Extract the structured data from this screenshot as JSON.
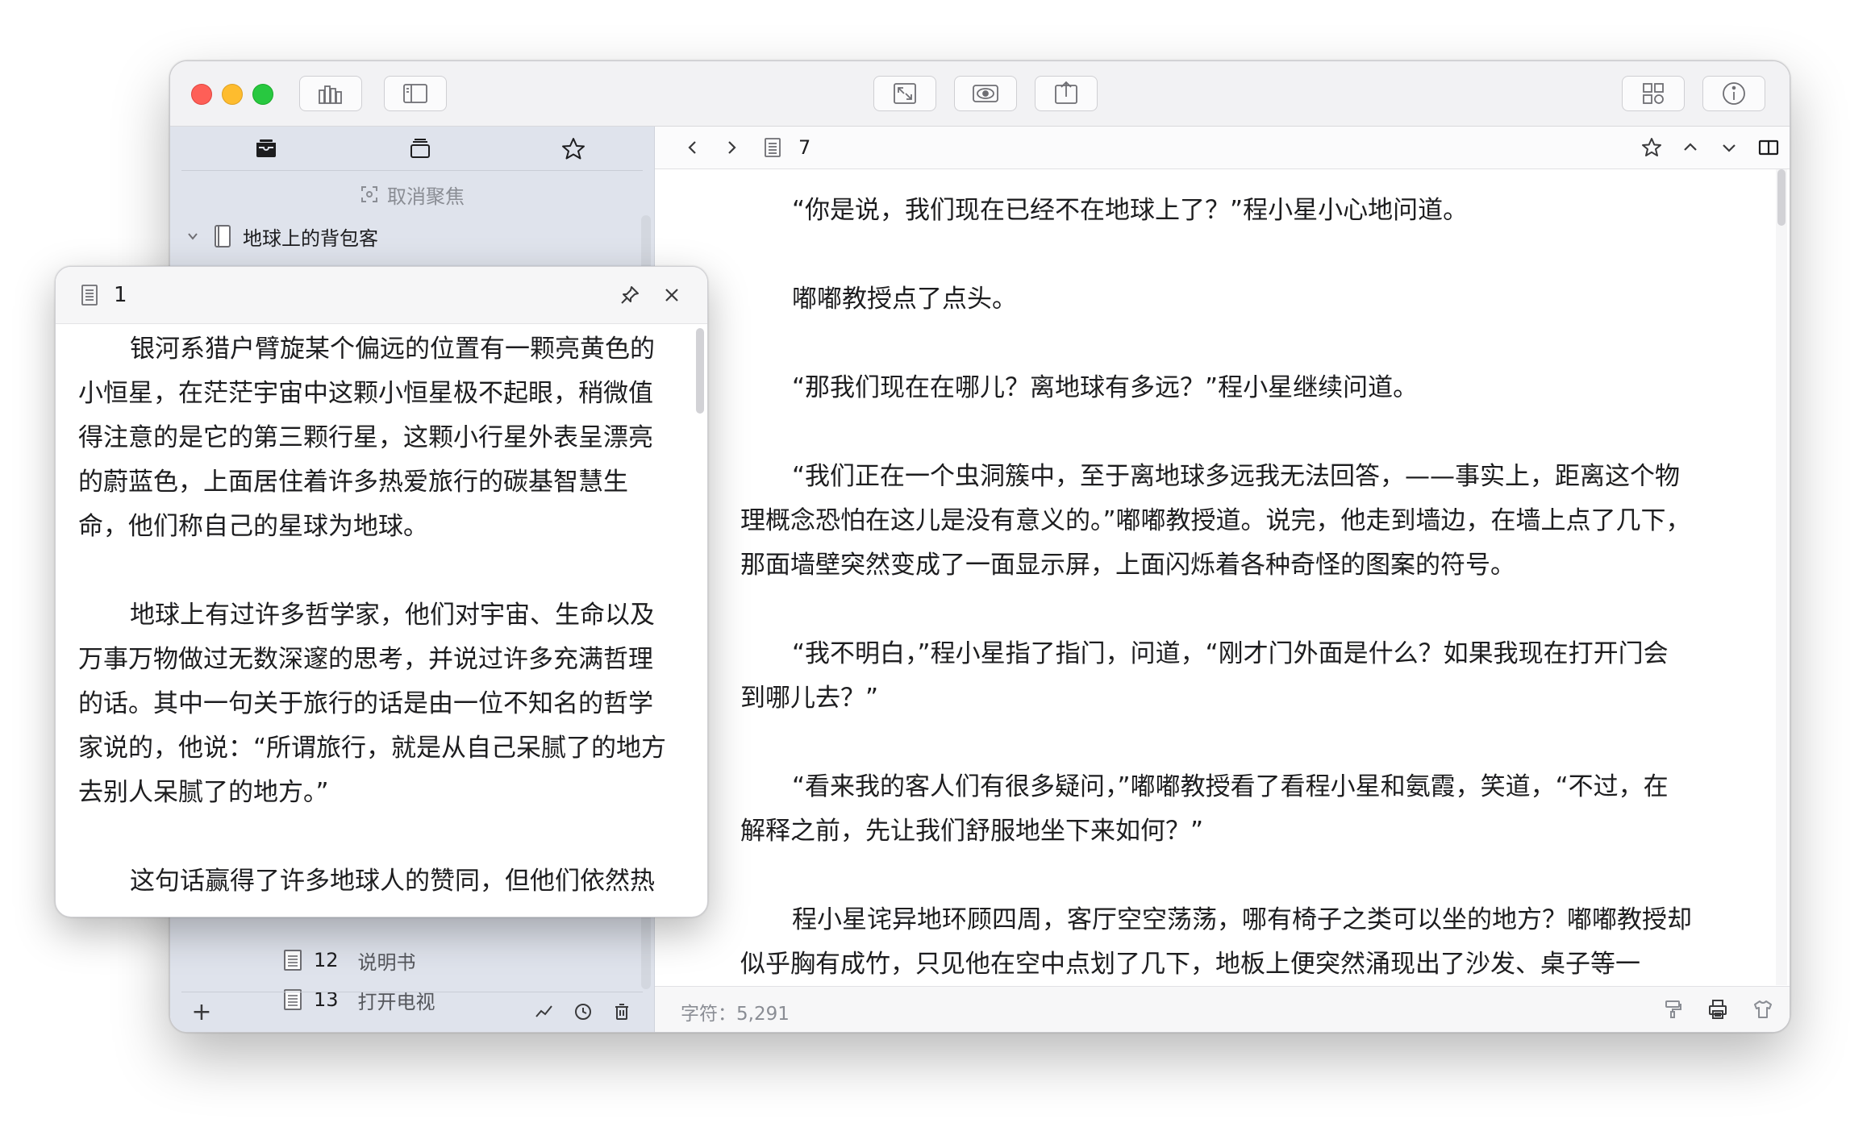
{
  "sidebar": {
    "unfocus_label": "取消聚焦",
    "root_item": "地球上的背包客",
    "items": [
      {
        "number": "12",
        "label": "说明书"
      },
      {
        "number": "13",
        "label": "打开电视"
      }
    ],
    "add_label": "+"
  },
  "editor": {
    "doc_title": "7",
    "paragraphs": [
      "“你是说，我们现在已经不在地球上了？”程小星小心地问道。",
      "嘟嘟教授点了点头。",
      "“那我们现在在哪儿？离地球有多远？”程小星继续问道。",
      "“我们正在一个虫洞簇中，至于离地球多远我无法回答，——事实上，距离这个物理概念恐怕在这儿是没有意义的。”嘟嘟教授道。说完，他走到墙边，在墙上点了几下，那面墙壁突然变成了一面显示屏，上面闪烁着各种奇怪的图案的符号。",
      "“我不明白，”程小星指了指门，问道，“刚才门外面是什么？如果我现在打开门会到哪儿去？”",
      "“看来我的客人们有很多疑问，”嘟嘟教授看了看程小星和氨霞，笑道，“不过，在解释之前，先让我们舒服地坐下来如何？”",
      "程小星诧异地环顾四周，客厅空空荡荡，哪有椅子之类可以坐的地方？嘟嘟教授却似乎胸有成竹，只见他在空中点划了几下，地板上便突然涌现出了沙发、桌子等一"
    ],
    "status": "字符：5,291"
  },
  "popover": {
    "title": "1",
    "paragraphs": [
      "银河系猎户臂旋某个偏远的位置有一颗亮黄色的小恒星，在茫茫宇宙中这颗小恒星极不起眼，稍微值得注意的是它的第三颗行星，这颗小行星外表呈漂亮的蔚蓝色，上面居住着许多热爱旅行的碳基智慧生命，他们称自己的星球为地球。",
      "地球上有过许多哲学家，他们对宇宙、生命以及万事万物做过无数深邃的思考，并说过许多充满哲理的话。其中一句关于旅行的话是由一位不知名的哲学家说的，他说：“所谓旅行，就是从自己呆腻了的地方去别人呆腻了的地方。”",
      "这句话赢得了许多地球人的赞同，但他们依然热"
    ]
  },
  "icons": {
    "toolbar": [
      "binder-icon",
      "sidebar-toggle-icon",
      "fullscreen-icon",
      "preview-eye-icon",
      "share-icon",
      "grid-view-icon",
      "info-icon"
    ],
    "sidebar_tabs": [
      "inbox-icon",
      "stack-icon",
      "star-icon"
    ],
    "nav": [
      "chevron-left-icon",
      "chevron-right-icon",
      "document-icon",
      "star-icon",
      "chevron-up-icon",
      "chevron-down-icon",
      "split-view-icon"
    ]
  },
  "colors": {
    "sidebar_bg": "#dfe3ec",
    "close": "#fe5f57",
    "minimize": "#febc2e",
    "maximize": "#28c840"
  }
}
